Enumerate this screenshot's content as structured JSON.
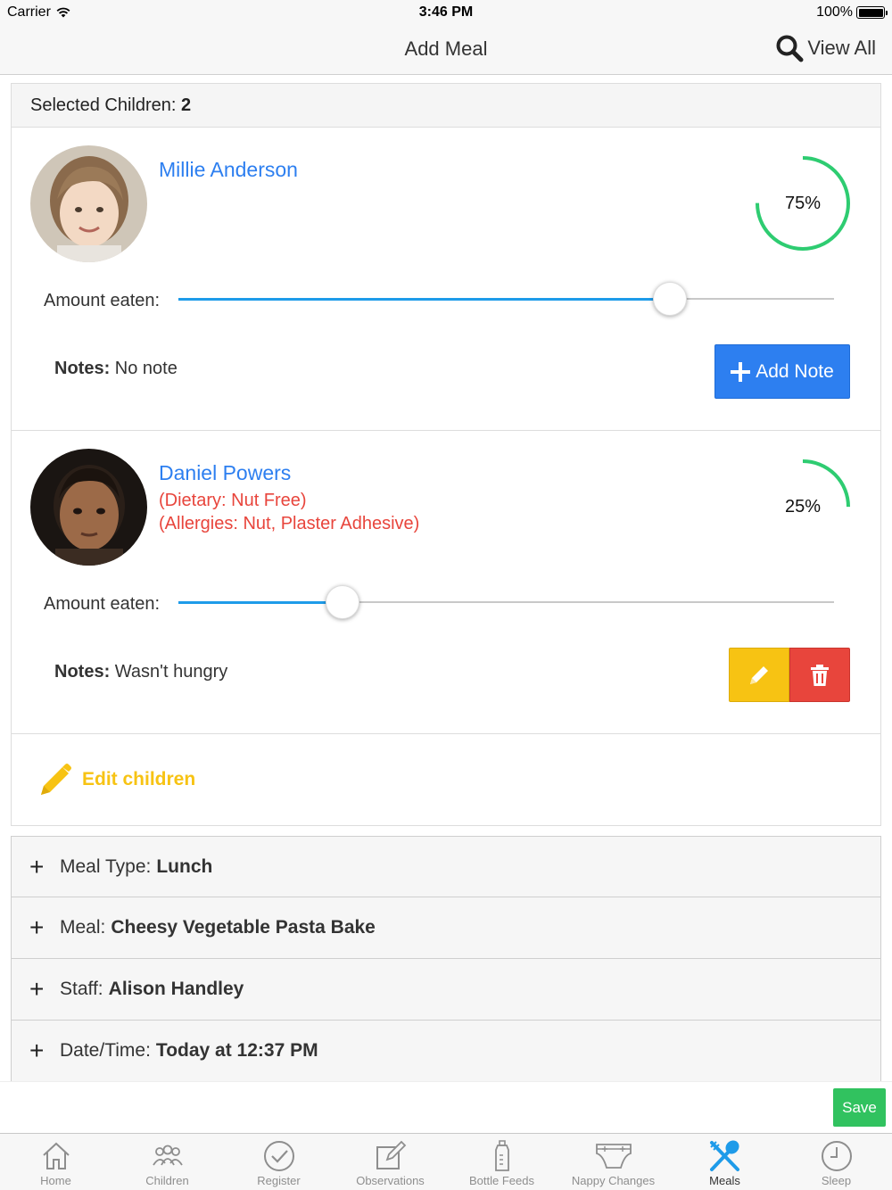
{
  "status_bar": {
    "carrier": "Carrier",
    "time": "3:46 PM",
    "battery": "100%"
  },
  "nav": {
    "title": "Add Meal",
    "view_all": "View All"
  },
  "selected": {
    "label": "Selected Children:",
    "count": "2"
  },
  "amount_label": "Amount eaten:",
  "notes_label": "Notes:",
  "children": [
    {
      "name": "Millie Anderson",
      "dietary": "",
      "allergies": "",
      "percent_label": "75%",
      "amount_eaten": 0.75,
      "notes": "No note",
      "add_note_label": "Add Note"
    },
    {
      "name": "Daniel Powers",
      "dietary": "(Dietary: Nut Free)",
      "allergies": "(Allergies: Nut, Plaster Adhesive)",
      "percent_label": "25%",
      "amount_eaten": 0.25,
      "notes": "Wasn't hungry"
    }
  ],
  "edit_children": "Edit children",
  "details": [
    {
      "label": "Meal Type:",
      "value": "Lunch"
    },
    {
      "label": "Meal:",
      "value": "Cheesy Vegetable Pasta Bake"
    },
    {
      "label": "Staff:",
      "value": "Alison Handley"
    },
    {
      "label": "Date/Time:",
      "value": "Today at 12:37 PM"
    }
  ],
  "save_label": "Save",
  "tabs": [
    {
      "label": "Home",
      "icon": "home-icon"
    },
    {
      "label": "Children",
      "icon": "children-icon"
    },
    {
      "label": "Register",
      "icon": "register-icon"
    },
    {
      "label": "Observations",
      "icon": "observations-icon"
    },
    {
      "label": "Bottle Feeds",
      "icon": "bottle-icon"
    },
    {
      "label": "Nappy Changes",
      "icon": "nappy-icon"
    },
    {
      "label": "Meals",
      "icon": "meals-icon",
      "active": true
    },
    {
      "label": "Sleep",
      "icon": "sleep-icon"
    }
  ],
  "colors": {
    "link_blue": "#2d7ff0",
    "progress_green": "#2ecc71",
    "slider_blue": "#1e9be9",
    "allergy_red": "#e8453c",
    "edit_yellow": "#f7c313",
    "save_green": "#31c25f"
  }
}
